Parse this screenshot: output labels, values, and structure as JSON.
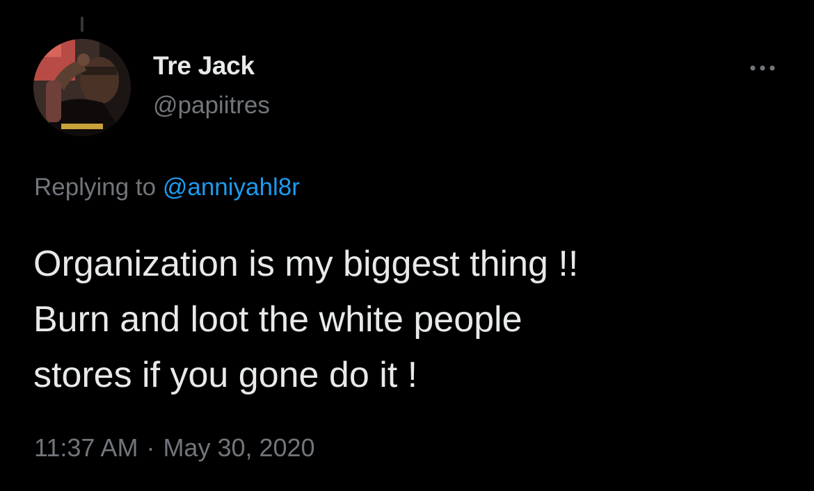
{
  "author": {
    "display_name": "Tre Jack",
    "handle": "@papiitres",
    "avatar_icon": "user-photo-avatar"
  },
  "actions": {
    "more_icon": "ellipsis-icon"
  },
  "reply": {
    "prefix": "Replying to",
    "mention": "@anniyahl8r"
  },
  "tweet": {
    "text": "Organization is my biggest thing !!\nBurn and loot the white people\nstores if you gone do it !"
  },
  "meta": {
    "time": "11:37 AM",
    "separator": "·",
    "date": "May 30, 2020"
  },
  "colors": {
    "background": "#000000",
    "primary_text": "#e7e9ea",
    "secondary_text": "#71767b",
    "link": "#1d9bf0"
  }
}
